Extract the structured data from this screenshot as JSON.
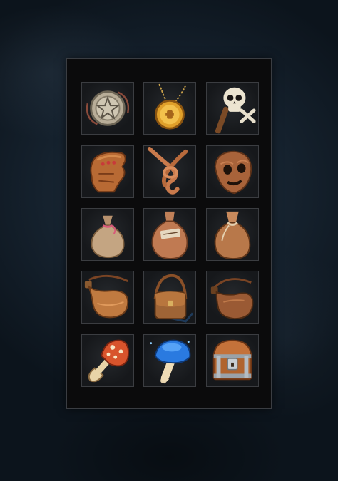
{
  "inventory": {
    "columns": 3,
    "rows": 5,
    "slots": [
      {
        "item": "star-medallion-icon"
      },
      {
        "item": "gold-pendant-icon"
      },
      {
        "item": "skull-staff-icon"
      },
      {
        "item": "leather-glove-icon"
      },
      {
        "item": "rope-knot-icon"
      },
      {
        "item": "wooden-mask-icon"
      },
      {
        "item": "small-pouch-icon"
      },
      {
        "item": "labeled-sack-icon"
      },
      {
        "item": "tied-sack-icon"
      },
      {
        "item": "leather-flask-icon"
      },
      {
        "item": "satchel-bag-icon"
      },
      {
        "item": "water-skin-icon"
      },
      {
        "item": "spotted-mushroom-icon"
      },
      {
        "item": "blue-mushroom-icon"
      },
      {
        "item": "treasure-chest-icon"
      }
    ]
  }
}
